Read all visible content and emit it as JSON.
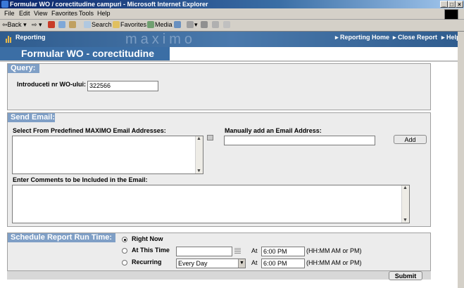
{
  "window": {
    "title": "Formular WO / corectitudine campuri - Microsoft Internet Explorer"
  },
  "menu": [
    "File",
    "Edit",
    "View",
    "Favorites",
    "Tools",
    "Help"
  ],
  "toolbar": {
    "back": "Back",
    "search": "Search",
    "favorites": "Favorites",
    "media": "Media"
  },
  "header": {
    "app_label": "Reporting",
    "logo_text": "maximo",
    "links": [
      "Reporting Home",
      "Close Report",
      "Help"
    ]
  },
  "form": {
    "title": "Formular WO - corectitudine"
  },
  "query": {
    "heading": "Query:",
    "wo_label": "Introduceti nr WO-ului:",
    "wo_value": "322566"
  },
  "email": {
    "heading": "Send Email:",
    "predefined_label": "Select From Predefined MAXIMO Email Addresses:",
    "manual_label": "Manually add an Email Address:",
    "manual_value": "",
    "add_button": "Add",
    "comments_label": "Enter Comments to be Included in the Email:"
  },
  "schedule": {
    "heading": "Schedule Report Run Time:",
    "options": {
      "right_now": "Right Now",
      "at_this_time": "At This Time",
      "recurring": "Recurring"
    },
    "selected": "Right Now",
    "at_label": "At",
    "time_hint": "(HH:MM AM or PM)",
    "time_at": "6:00 PM",
    "time_recurring": "6:00 PM",
    "recurrence": "Every Day",
    "submit": "Submit"
  },
  "colors": {
    "title_blue": "#3b6ea5",
    "section_head": "#7f9fc6",
    "header_blue": "#2f5c8e"
  }
}
